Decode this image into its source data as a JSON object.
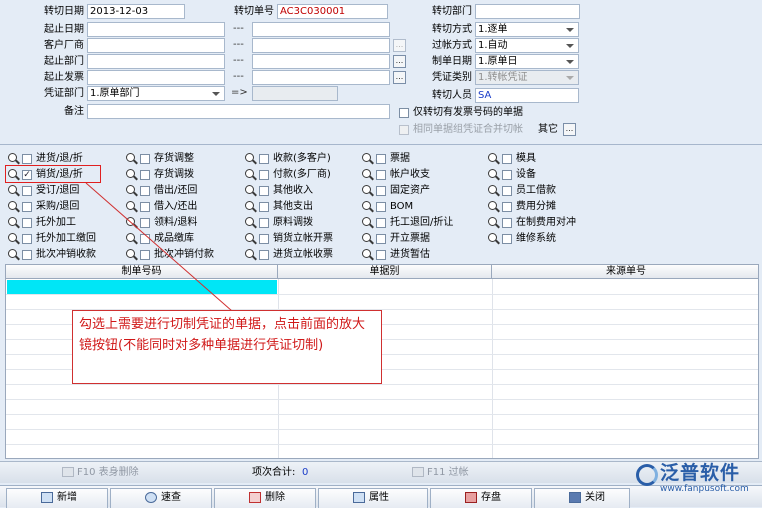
{
  "form": {
    "date_label": "转切日期",
    "date_value": "2013-12-03",
    "no_label": "转切单号",
    "no_value": "AC3C030001",
    "dept_label": "转切部门",
    "dept_value": "",
    "start_date_label": "起止日期",
    "customer_label": "客户厂商",
    "start_dept_label": "起止部门",
    "start_invoice_label": "起止发票",
    "voucher_dept_label": "凭证部门",
    "voucher_dept_value": "1.原单部门",
    "arrow_text": "=>",
    "remark_label": "备注",
    "dash": "---",
    "ellipsis": "...",
    "mode_label": "转切方式",
    "mode_value": "1.逐单",
    "post_label": "过帐方式",
    "post_value": "1.自动",
    "make_date_label": "制单日期",
    "make_date_value": "1.原单日",
    "voucher_type_label": "凭证类别",
    "voucher_type_value": "1.转帐凭证",
    "person_label": "转切人员",
    "person_value": "SA",
    "only_invoice_label": "仅转切有发票号码的单据",
    "merge_label": "相同单据组凭证合并切帐",
    "other_label": "其它",
    "other_btn": "..."
  },
  "bills": [
    {
      "label": "进货/退/折",
      "checked": false
    },
    {
      "label": "销货/退/折",
      "checked": true
    },
    {
      "label": "受订/退回",
      "checked": false
    },
    {
      "label": "采购/退回",
      "checked": false
    },
    {
      "label": "托外加工",
      "checked": false
    },
    {
      "label": "托外加工缴回",
      "checked": false
    },
    {
      "label": "批次冲销收款",
      "checked": false
    },
    {
      "label": "存货调整",
      "checked": false
    },
    {
      "label": "存货调拨",
      "checked": false
    },
    {
      "label": "借出/还回",
      "checked": false
    },
    {
      "label": "借入/还出",
      "checked": false
    },
    {
      "label": "领料/退料",
      "checked": false
    },
    {
      "label": "成品缴库",
      "checked": false
    },
    {
      "label": "批次冲销付款",
      "checked": false
    },
    {
      "label": "收款(多客户)",
      "checked": false
    },
    {
      "label": "付款(多厂商)",
      "checked": false
    },
    {
      "label": "其他收入",
      "checked": false
    },
    {
      "label": "其他支出",
      "checked": false
    },
    {
      "label": "原料调拨",
      "checked": false
    },
    {
      "label": "销货立帐开票",
      "checked": false
    },
    {
      "label": "进货立帐收票",
      "checked": false
    },
    {
      "label": "票据",
      "checked": false
    },
    {
      "label": "帐户收支",
      "checked": false
    },
    {
      "label": "固定资产",
      "checked": false
    },
    {
      "label": "BOM",
      "checked": false
    },
    {
      "label": "托工退回/折让",
      "checked": false
    },
    {
      "label": "开立票据",
      "checked": false
    },
    {
      "label": "进货暂估",
      "checked": false
    },
    {
      "label": "模具",
      "checked": false
    },
    {
      "label": "设备",
      "checked": false
    },
    {
      "label": "员工借款",
      "checked": false
    },
    {
      "label": "费用分摊",
      "checked": false
    },
    {
      "label": "在制费用对冲",
      "checked": false
    },
    {
      "label": "维修系统",
      "checked": false
    }
  ],
  "grid": {
    "columns": [
      "制单号码",
      "单据别",
      "来源单号"
    ]
  },
  "callout": {
    "text": "勾选上需要进行切制凭证的单据，点击前面的放大镜按钮(不能同时对多种单据进行凭证切制)"
  },
  "footer": {
    "delete_label": "F10 表身删除",
    "total_label": "项次合计:",
    "total_value": "0",
    "filter_label": "F11 过帐"
  },
  "toolbar": {
    "new_label": "新增",
    "query_label": "速查",
    "delete_label": "删除",
    "attr_label": "属性",
    "save_label": "存盘",
    "close_label": "关闭"
  },
  "logo": {
    "name": "泛普软件",
    "url": "www.fanpusoft.com"
  }
}
